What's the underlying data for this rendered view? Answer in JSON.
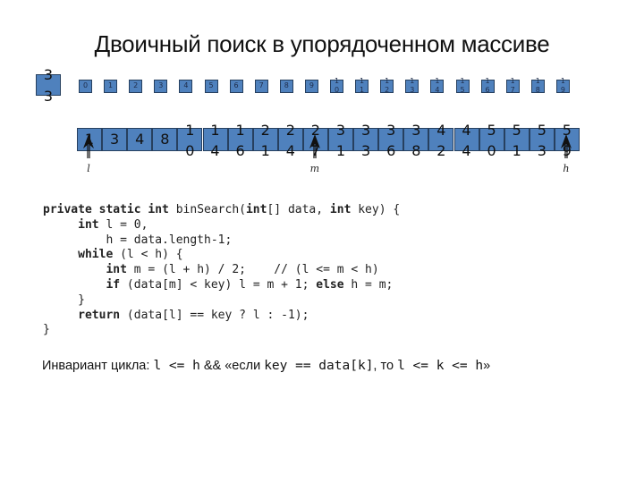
{
  "title": "Двоичный поиск в упорядоченном массиве",
  "colors": {
    "box_fill": "#4f81bd",
    "box_border": "#27405f"
  },
  "key": "33",
  "indices": [
    "0",
    "1",
    "2",
    "3",
    "4",
    "5",
    "6",
    "7",
    "8",
    "9",
    "10",
    "11",
    "12",
    "13",
    "14",
    "15",
    "16",
    "17",
    "18",
    "19"
  ],
  "values": [
    "1",
    "3",
    "4",
    "8",
    "10",
    "14",
    "16",
    "21",
    "24",
    "27",
    "31",
    "33",
    "36",
    "38",
    "42",
    "44",
    "50",
    "51",
    "53",
    "59"
  ],
  "pointers": [
    {
      "label": "l",
      "index": 0,
      "icon": "arrow-up-icon"
    },
    {
      "label": "m",
      "index": 9,
      "icon": "arrow-up-icon"
    },
    {
      "label": "h",
      "index": 19,
      "icon": "arrow-up-icon"
    }
  ],
  "code": [
    [
      [
        "kw",
        "private static int"
      ],
      [
        "t",
        " binSearch("
      ],
      [
        "kw",
        "int"
      ],
      [
        "t",
        "[] data, "
      ],
      [
        "kw",
        "int"
      ],
      [
        "t",
        " key) {"
      ]
    ],
    [
      [
        "t",
        "     "
      ],
      [
        "kw",
        "int"
      ],
      [
        "t",
        " l = 0,"
      ]
    ],
    [
      [
        "t",
        "         h = data.length-1;"
      ]
    ],
    [
      [
        "t",
        "     "
      ],
      [
        "kw",
        "while"
      ],
      [
        "t",
        " (l < h) {"
      ]
    ],
    [
      [
        "t",
        "         "
      ],
      [
        "kw",
        "int"
      ],
      [
        "t",
        " m = (l + h) / 2;    // (l <= m < h)"
      ]
    ],
    [
      [
        "t",
        "         "
      ],
      [
        "kw",
        "if"
      ],
      [
        "t",
        " (data[m] < key) l = m + 1; "
      ],
      [
        "kw",
        "else"
      ],
      [
        "t",
        " h = m;"
      ]
    ],
    [
      [
        "t",
        "     }"
      ]
    ],
    [
      [
        "t",
        "     "
      ],
      [
        "kw",
        "return"
      ],
      [
        "t",
        " (data[l] == key ? l : -1);"
      ]
    ],
    [
      [
        "t",
        "}"
      ]
    ]
  ],
  "invariant": [
    [
      "text",
      "Инвариант цикла: "
    ],
    [
      "mono",
      "l <= h"
    ],
    [
      "text",
      " && «если "
    ],
    [
      "mono",
      "key == data[k]"
    ],
    [
      "text",
      ", то "
    ],
    [
      "mono",
      "l <= k <= h"
    ],
    [
      "text",
      "»"
    ]
  ]
}
